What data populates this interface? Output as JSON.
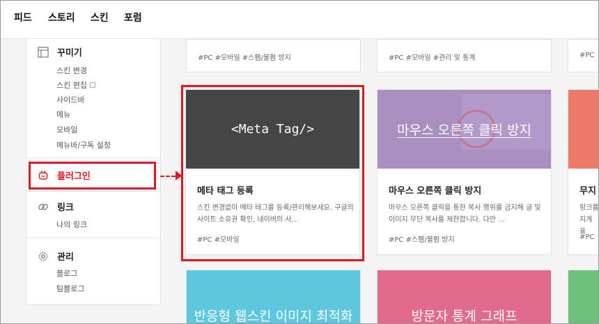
{
  "nav": {
    "items": [
      "피드",
      "스토리",
      "스킨",
      "포럼"
    ]
  },
  "sidebar": {
    "sections": {
      "decorate": {
        "icon": "layout-icon",
        "title": "꾸미기",
        "items": [
          "스킨 변경",
          "스킨 편집",
          "사이드바",
          "메뉴",
          "모바일",
          "메뉴바/구독 설정"
        ]
      },
      "plugin": {
        "icon": "plug-icon",
        "title": "플러그인"
      },
      "link": {
        "icon": "link-icon",
        "title": "링크",
        "items": [
          "나의 링크"
        ]
      },
      "manage": {
        "icon": "gear-icon",
        "title": "관리",
        "items": [
          "블로그",
          "팀블로그"
        ]
      }
    },
    "accent_color": "#e3161d"
  },
  "cards": {
    "top_row": [
      {
        "tags": "#PC   #모바일   #스펨/불펌 방지"
      },
      {
        "tags": "#PC   #모바일   #관리 및 통계"
      },
      {
        "tags": "#PC"
      }
    ],
    "meta": {
      "thumb_text": "<Meta Tag/>",
      "title": "메타 태그 등록",
      "desc": "스킨 변경없이 메타 태그를 등록/관리해보세요. 구글의 사이트 소유권 확인, 네이버의 사…",
      "tags": "#PC   #모바일",
      "thumb_color": "#454545"
    },
    "rightclick": {
      "thumb_text": "마우스 오른쪽 클릭 방지",
      "title": "마우스 오른쪽 클릭 방지",
      "desc": "마우스 오른쪽 클릭을 통한 복사 행위를 금지해 글 및 이미지 무단 복사를 제한합니다. 다만 …",
      "tags": "#PC   #스펨/불펌 방지",
      "thumb_color": "#a88fc0"
    },
    "partial": {
      "title": "무지",
      "desc": "링크를 지게 표",
      "tags": "#PC",
      "thumb_color": "#f07a6a"
    },
    "bottom_row": [
      {
        "thumb_text": "반응형 웹스킨 이미지 최적화",
        "thumb_color": "#5bc8e0"
      },
      {
        "thumb_text": "방문자 통계 그래프",
        "thumb_color": "#e26a8c"
      },
      {
        "thumb_color": "#6cc07a"
      }
    ]
  }
}
